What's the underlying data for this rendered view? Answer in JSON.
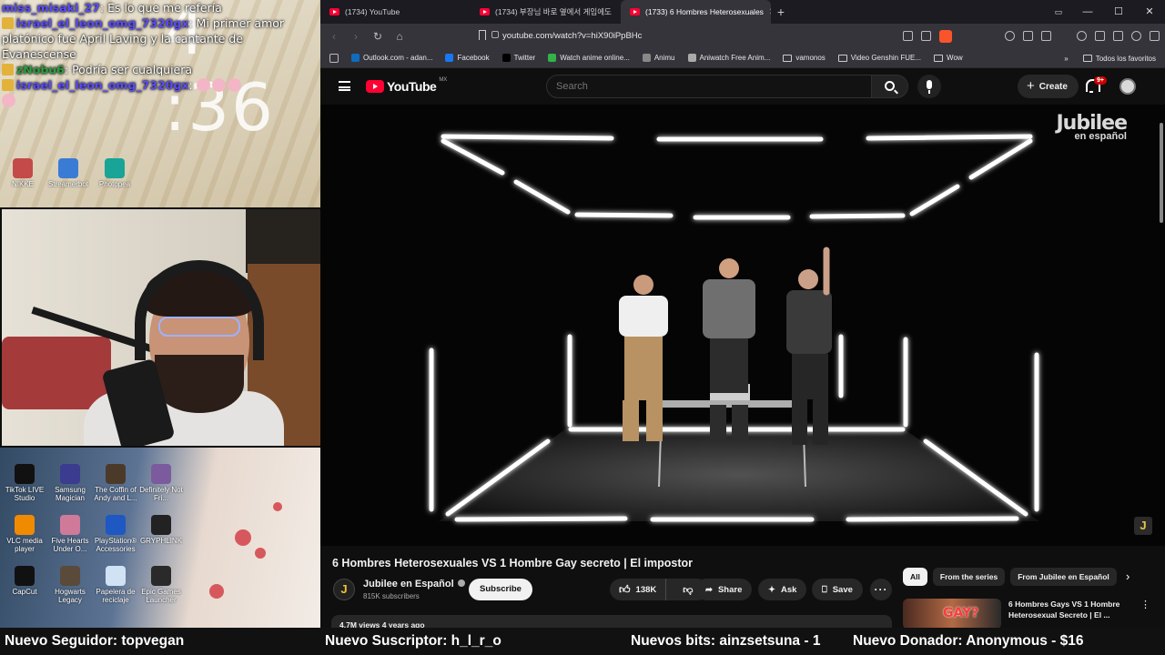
{
  "overlay": {
    "clock": "4 :36",
    "chat": [
      {
        "user": "miss_misaki_27",
        "text": "Es lo que me refería",
        "user_color": "#5b4cff"
      },
      {
        "user": "israel_el_leon_omg_7320gx",
        "text": "Mi primer amor platónico fue April Laving y la cantante de Evanescense",
        "user_color": "#5b4cff"
      },
      {
        "user": "zNobu6",
        "text": "Podría ser cualquiera",
        "user_color": "#2f9e41"
      },
      {
        "user": "israel_el_leon_omg_7320gx",
        "text": "",
        "user_color": "#5b4cff"
      }
    ],
    "desktop_icons_top": [
      {
        "label": "NIKKE",
        "icon": "nikke-icon",
        "color": "#c44a4a"
      },
      {
        "label": "Streamerbot",
        "icon": "streamerbot-icon",
        "color": "#3a7bd5"
      },
      {
        "label": "Photopea",
        "icon": "photopea-icon",
        "color": "#18a497"
      }
    ],
    "desktop_icons_bottom": [
      {
        "label": "TikTok LIVE Studio",
        "icon": "tiktok-icon",
        "color": "#111111"
      },
      {
        "label": "Samsung Magician",
        "icon": "samsung-magician-icon",
        "color": "#3b3b8f"
      },
      {
        "label": "The Coffin of Andy and L...",
        "icon": "coffin-game-icon",
        "color": "#4b3a2a"
      },
      {
        "label": "Definitely Not Fri...",
        "icon": "definitely-game-icon",
        "color": "#7b5b9e"
      },
      {
        "label": "VLC media player",
        "icon": "vlc-icon",
        "color": "#f08a00"
      },
      {
        "label": "Five Hearts Under O...",
        "icon": "five-hearts-icon",
        "color": "#d07a9a"
      },
      {
        "label": "PlayStation® Accessories",
        "icon": "playstation-icon",
        "color": "#1f57c3"
      },
      {
        "label": "GRYPHLINK",
        "icon": "gryphlink-icon",
        "color": "#222222"
      },
      {
        "label": "CapCut",
        "icon": "capcut-icon",
        "color": "#111111"
      },
      {
        "label": "Hogwarts Legacy",
        "icon": "hogwarts-icon",
        "color": "#5a4a3a"
      },
      {
        "label": "Papelera de reciclaje",
        "icon": "recycle-bin-icon",
        "color": "#cfe3f5"
      },
      {
        "label": "Epic Games Launcher",
        "icon": "epic-games-icon",
        "color": "#2a2a2a"
      }
    ]
  },
  "browser": {
    "tabs": [
      {
        "title": "(1734) YouTube",
        "active": false
      },
      {
        "title": "(1734) 부장님 바로 옆에서 게임에도",
        "active": false
      },
      {
        "title": "(1733) 6 Hombres Heterosexuales",
        "active": true
      }
    ],
    "url": "youtube.com/watch?v=hiX90iPpBHc",
    "bookmarks": [
      {
        "label": "Outlook.com - adan...",
        "color": "#0f6cbd",
        "type": "site"
      },
      {
        "label": "Facebook",
        "color": "#1877f2",
        "type": "site"
      },
      {
        "label": "Twitter",
        "color": "#000000",
        "type": "site"
      },
      {
        "label": "Watch anime online...",
        "color": "#31b34a",
        "type": "site"
      },
      {
        "label": "Animu",
        "color": "#888888",
        "type": "site"
      },
      {
        "label": "Aniwatch Free Anim...",
        "color": "#aaaaaa",
        "type": "site"
      },
      {
        "label": "vamonos",
        "color": "",
        "type": "folder"
      },
      {
        "label": "Video Genshin FUE...",
        "color": "",
        "type": "folder"
      },
      {
        "label": "Wow",
        "color": "",
        "type": "folder"
      }
    ],
    "bookmarks_more": "»",
    "all_bookmarks": "Todos los favoritos"
  },
  "youtube": {
    "logo": "YouTube",
    "region": "MX",
    "search_placeholder": "Search",
    "create_label": "Create",
    "notifications": "9+",
    "watermark_line1": "Jubilee",
    "watermark_line2": "en español",
    "corner_logo": "J",
    "video_title": "6 Hombres Heterosexuales VS 1 Hombre Gay secreto | El impostor",
    "channel": {
      "name": "Jubilee en Español",
      "subs": "815K subscribers",
      "avatar": "J"
    },
    "subscribe_label": "Subscribe",
    "likes": "138K",
    "share_label": "Share",
    "ask_label": "Ask",
    "save_label": "Save",
    "description_meta": "4.7M views  4 years ago",
    "chips": [
      {
        "label": "All",
        "active": true
      },
      {
        "label": "From the series",
        "active": false
      },
      {
        "label": "From Jubilee en Español",
        "active": false
      }
    ],
    "recommendation": {
      "title": "6 Hombres Gays VS 1 Hombre Heterosexual Secreto | El ...",
      "thumb_text": "GAY?"
    }
  },
  "ticker": [
    "Nuevo Seguidor: topvegan",
    "Nuevo Suscriptor: h_l_r_o",
    "Nuevos bits: ainzsetsuna - 1",
    "Nuevo Donador: Anonymous - $16"
  ]
}
